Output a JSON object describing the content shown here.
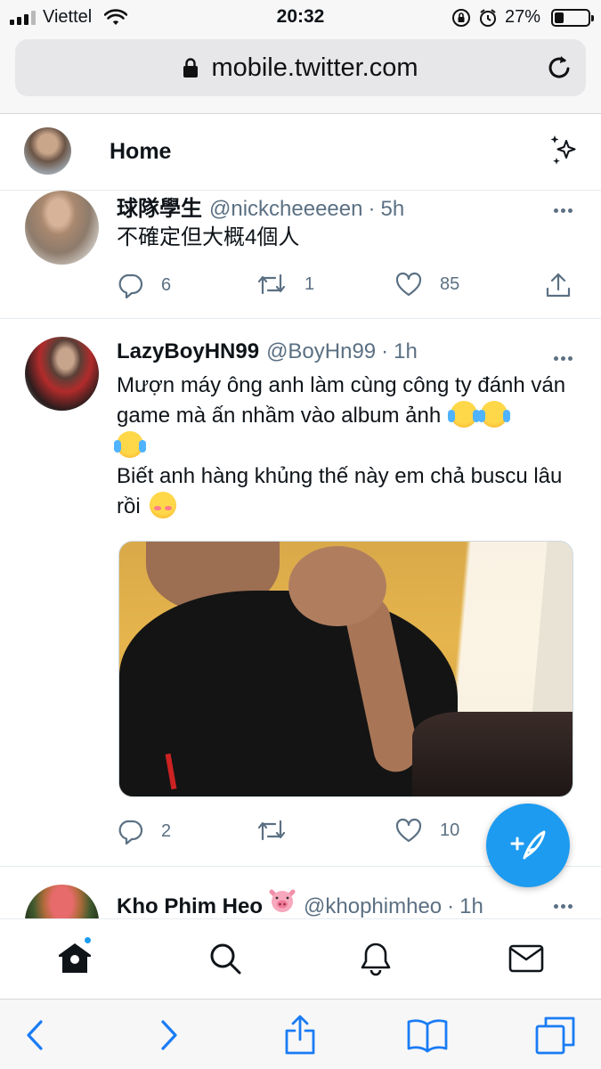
{
  "status_bar": {
    "carrier": "Viettel",
    "time": "20:32",
    "battery_percent": "27%",
    "battery_level": 0.27
  },
  "browser": {
    "url": "mobile.twitter.com"
  },
  "header": {
    "title": "Home"
  },
  "tweets": [
    {
      "name": "球隊學生",
      "handle": "@nickcheeeeen",
      "time": "5h",
      "text": "不確定但大概4個人",
      "replies": "6",
      "retweets": "1",
      "likes": "85"
    },
    {
      "name": "LazyBoyHN99",
      "handle": "@BoyHn99",
      "time": "1h",
      "text_line1": "Mượn máy ông anh làm cùng công ty đánh ván game mà ấn nhầm vào album ảnh",
      "text_line2": "Biết anh hàng khủng thế này em chả buscu lâu rồi",
      "replies": "2",
      "retweets": "",
      "likes": "10"
    },
    {
      "name": "Kho Phim Heo",
      "handle": "@khophimheo",
      "time": "1h"
    }
  ],
  "icons": {
    "header_right": "sparkle-icon",
    "compose": "compose-tweet-icon",
    "nav": [
      "home-icon",
      "search-icon",
      "bell-icon",
      "mail-icon"
    ],
    "safari": [
      "back-icon",
      "forward-icon",
      "share-icon",
      "bookmarks-icon",
      "tabs-icon"
    ]
  },
  "colors": {
    "accent": "#1d9bf0",
    "secondary_text": "#5b7083"
  }
}
